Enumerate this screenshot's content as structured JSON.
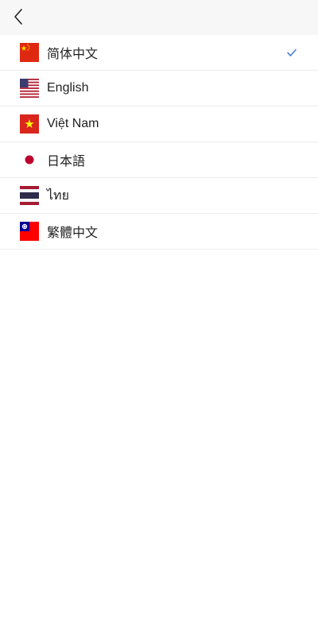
{
  "header": {
    "back_icon": "chevron-left-icon"
  },
  "languages": [
    {
      "label": "简体中文",
      "flag": "china-flag-icon",
      "selected": true
    },
    {
      "label": "English",
      "flag": "usa-flag-icon",
      "selected": false
    },
    {
      "label": "Việt Nam",
      "flag": "vietnam-flag-icon",
      "selected": false
    },
    {
      "label": "日本語",
      "flag": "japan-flag-icon",
      "selected": false
    },
    {
      "label": "ไทย",
      "flag": "thailand-flag-icon",
      "selected": false
    },
    {
      "label": "繁體中文",
      "flag": "taiwan-flag-icon",
      "selected": false
    }
  ],
  "colors": {
    "header_bg": "#f7f7f7",
    "check": "#4a7fd8",
    "divider": "#ececec"
  }
}
